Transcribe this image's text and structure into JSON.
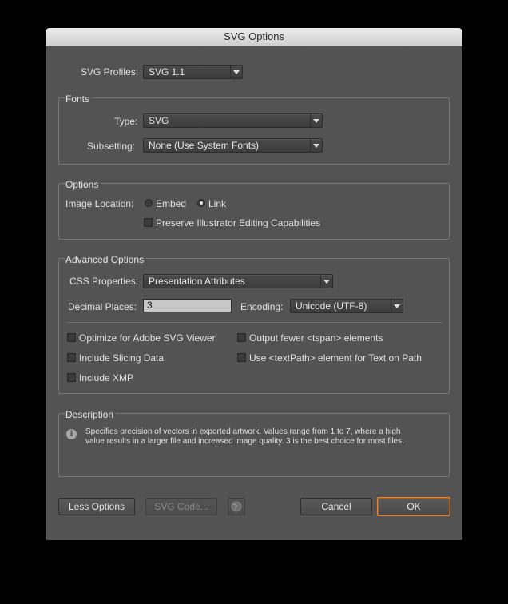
{
  "window": {
    "title": "SVG Options"
  },
  "profiles": {
    "label": "SVG Profiles:",
    "value": "SVG 1.1"
  },
  "fonts": {
    "title": "Fonts",
    "type_label": "Type:",
    "type_value": "SVG",
    "subsetting_label": "Subsetting:",
    "subsetting_value": "None (Use System Fonts)"
  },
  "options": {
    "title": "Options",
    "image_location_label": "Image Location:",
    "embed_label": "Embed",
    "link_label": "Link",
    "selected": "Link",
    "preserve_label": "Preserve Illustrator Editing Capabilities"
  },
  "advanced": {
    "title": "Advanced Options",
    "css_label": "CSS Properties:",
    "css_value": "Presentation Attributes",
    "decimal_label": "Decimal Places:",
    "decimal_value": "3",
    "encoding_label": "Encoding:",
    "encoding_value": "Unicode (UTF-8)",
    "optimize_label": "Optimize for Adobe SVG Viewer",
    "slicing_label": "Include Slicing Data",
    "xmp_label": "Include XMP",
    "tspan_label": "Output fewer <tspan> elements",
    "textpath_label": "Use <textPath> element for Text on Path"
  },
  "description": {
    "title": "Description",
    "line1": "Specifies precision of vectors in exported artwork. Values range from 1 to 7, where a high",
    "line2": "value results in a larger file and increased image quality. 3 is the best choice for most files."
  },
  "buttons": {
    "less_options": "Less Options",
    "svg_code": "SVG Code...",
    "cancel": "Cancel",
    "ok": "OK"
  },
  "colors": {
    "accent_focus": "#e08a3c",
    "dialog_bg": "#535353"
  },
  "icons": {
    "info": "info-icon",
    "web": "globe-icon"
  }
}
